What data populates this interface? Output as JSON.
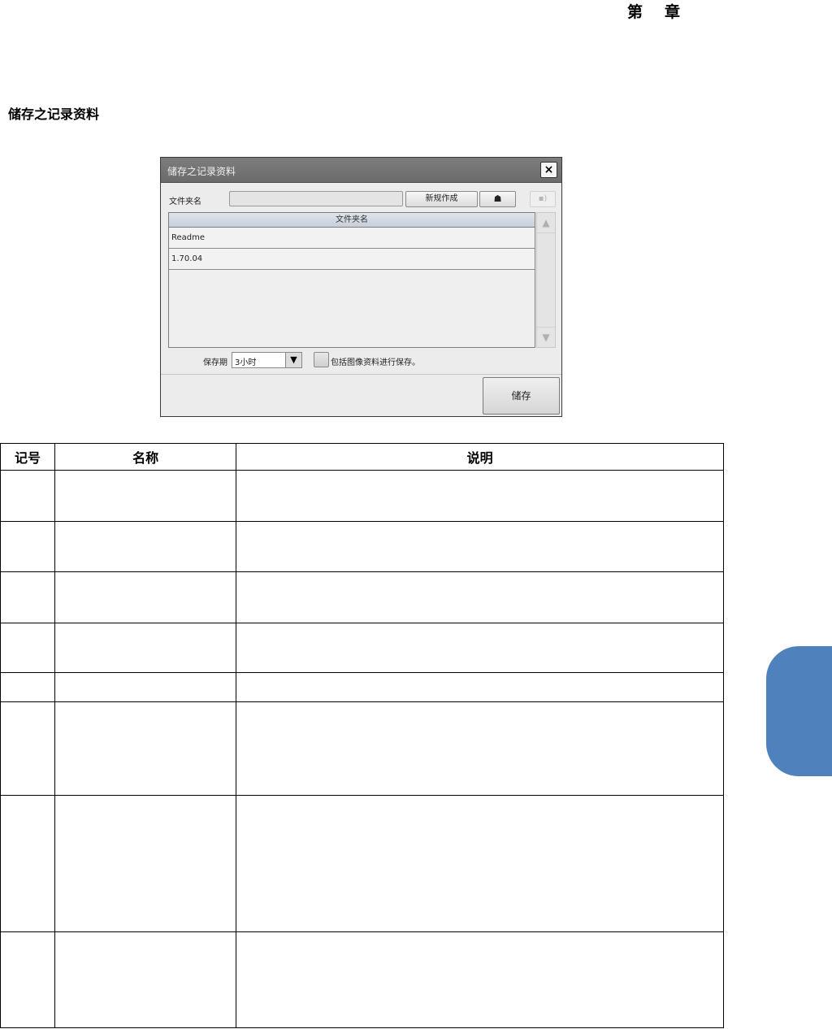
{
  "header": {
    "chapter_prefix": "第",
    "chapter_suffix": "章"
  },
  "section": {
    "title": "储存之记录资料"
  },
  "dialog": {
    "title": "储存之记录资料",
    "close_label": "×",
    "folder_label": "文件夹名",
    "folder_input_value": "",
    "new_button_label": "新规作成",
    "open_folder_glyph": "☗",
    "up_button_glyph": "▪)",
    "list_header": "文件夹名",
    "list_items": [
      "Readme",
      "1.70.04"
    ],
    "scroll_up_glyph": "▲",
    "scroll_down_glyph": "▼",
    "period_label": "保存期",
    "period_value": "3小时",
    "dropdown_glyph": "▼",
    "checkbox_label": "包括图像资料进行保存。",
    "checkbox_checked": false,
    "save_button_label": "储存",
    "icons": {
      "open_folder": "folder-open-icon",
      "up_folder": "folder-up-icon"
    }
  },
  "table": {
    "headers": [
      "记号",
      "名称",
      "说明"
    ],
    "row_count": 8
  },
  "colors": {
    "side_tab": "#4f81bd",
    "dialog_titlebar": "#737373"
  }
}
